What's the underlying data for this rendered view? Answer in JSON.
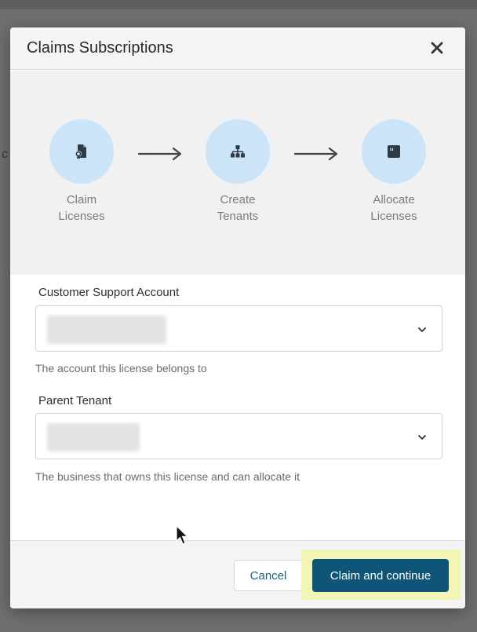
{
  "modal": {
    "title": "Claims Subscriptions"
  },
  "steps": [
    {
      "line1": "Claim",
      "line2": "Licenses",
      "icon": "claim-licenses-icon"
    },
    {
      "line1": "Create",
      "line2": "Tenants",
      "icon": "create-tenants-icon"
    },
    {
      "line1": "Allocate",
      "line2": "Licenses",
      "icon": "allocate-licenses-icon"
    }
  ],
  "form": {
    "customer_support_account": {
      "label": "Customer Support Account",
      "helper": "The account this license belongs to"
    },
    "parent_tenant": {
      "label": "Parent Tenant",
      "helper": "The business that owns this license and can allocate it"
    }
  },
  "footer": {
    "cancel_label": "Cancel",
    "primary_label": "Claim and continue"
  },
  "colors": {
    "primary": "#0f5577",
    "step_circle": "#cbe4f8",
    "highlight": "#f3f5b6",
    "link": "#1a5f8a"
  }
}
